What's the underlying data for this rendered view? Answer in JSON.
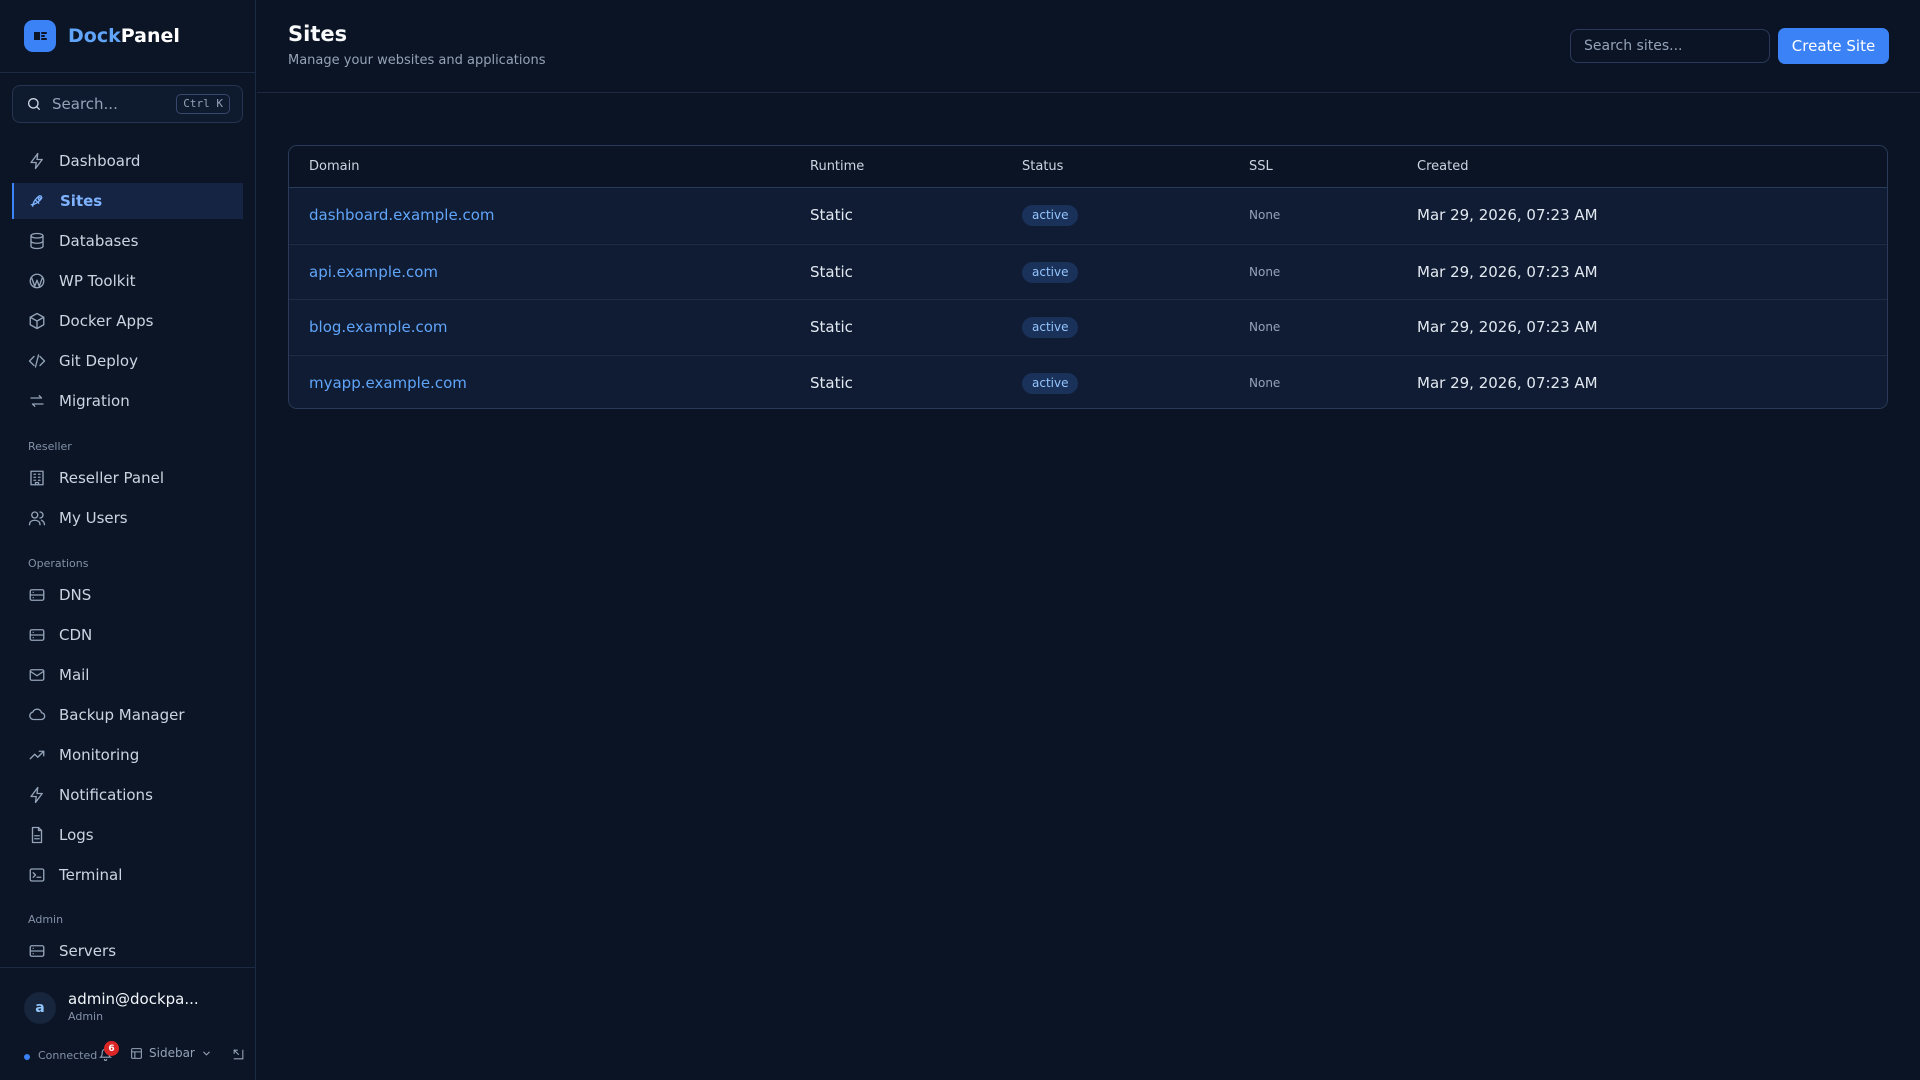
{
  "app": {
    "brand_a": "Dock",
    "brand_b": "Panel"
  },
  "sidebar": {
    "search_placeholder": "Search...",
    "search_shortcut": "Ctrl K",
    "items": [
      {
        "label": "Dashboard",
        "icon": "bolt-icon"
      },
      {
        "label": "Sites",
        "icon": "rocket-icon",
        "active": true
      },
      {
        "label": "Databases",
        "icon": "database-icon"
      },
      {
        "label": "WP Toolkit",
        "icon": "wordpress-icon"
      },
      {
        "label": "Docker Apps",
        "icon": "box-icon"
      },
      {
        "label": "Git Deploy",
        "icon": "code-icon"
      },
      {
        "label": "Migration",
        "icon": "arrows-icon"
      }
    ],
    "section_reseller": "Reseller",
    "reseller_items": [
      {
        "label": "Reseller Panel",
        "icon": "building-icon"
      },
      {
        "label": "My Users",
        "icon": "users-icon"
      }
    ],
    "section_operations": "Operations",
    "operations_items": [
      {
        "label": "DNS",
        "icon": "server-icon"
      },
      {
        "label": "CDN",
        "icon": "server-icon"
      },
      {
        "label": "Mail",
        "icon": "mail-icon"
      },
      {
        "label": "Backup Manager",
        "icon": "cloud-icon"
      },
      {
        "label": "Monitoring",
        "icon": "trend-icon"
      },
      {
        "label": "Notifications",
        "icon": "bolt-icon"
      },
      {
        "label": "Logs",
        "icon": "file-icon"
      },
      {
        "label": "Terminal",
        "icon": "terminal-icon"
      }
    ],
    "section_admin": "Admin",
    "admin_items": [
      {
        "label": "Servers",
        "icon": "server-icon"
      }
    ],
    "user": {
      "initial": "a",
      "email": "admin@dockpa...",
      "role": "Admin"
    },
    "status": {
      "connected": "Connected",
      "notification_count": "6",
      "sidebar_label": "Sidebar"
    }
  },
  "header": {
    "title": "Sites",
    "subtitle": "Manage your websites and applications",
    "search_placeholder": "Search sites...",
    "create_button": "Create Site"
  },
  "table": {
    "columns": [
      "Domain",
      "Runtime",
      "Status",
      "SSL",
      "Created"
    ],
    "rows": [
      {
        "domain": "dashboard.example.com",
        "runtime": "Static",
        "status": "active",
        "ssl": "None",
        "created": "Mar 29, 2026, 07:23 AM"
      },
      {
        "domain": "api.example.com",
        "runtime": "Static",
        "status": "active",
        "ssl": "None",
        "created": "Mar 29, 2026, 07:23 AM"
      },
      {
        "domain": "blog.example.com",
        "runtime": "Static",
        "status": "active",
        "ssl": "None",
        "created": "Mar 29, 2026, 07:23 AM"
      },
      {
        "domain": "myapp.example.com",
        "runtime": "Static",
        "status": "active",
        "ssl": "None",
        "created": "Mar 29, 2026, 07:23 AM"
      }
    ]
  },
  "colors": {
    "accent": "#3b82f6",
    "background": "#0b1424",
    "badge_bg": "#1a315a",
    "badge_text": "#93c5fd",
    "notification_badge": "#dc2626"
  }
}
